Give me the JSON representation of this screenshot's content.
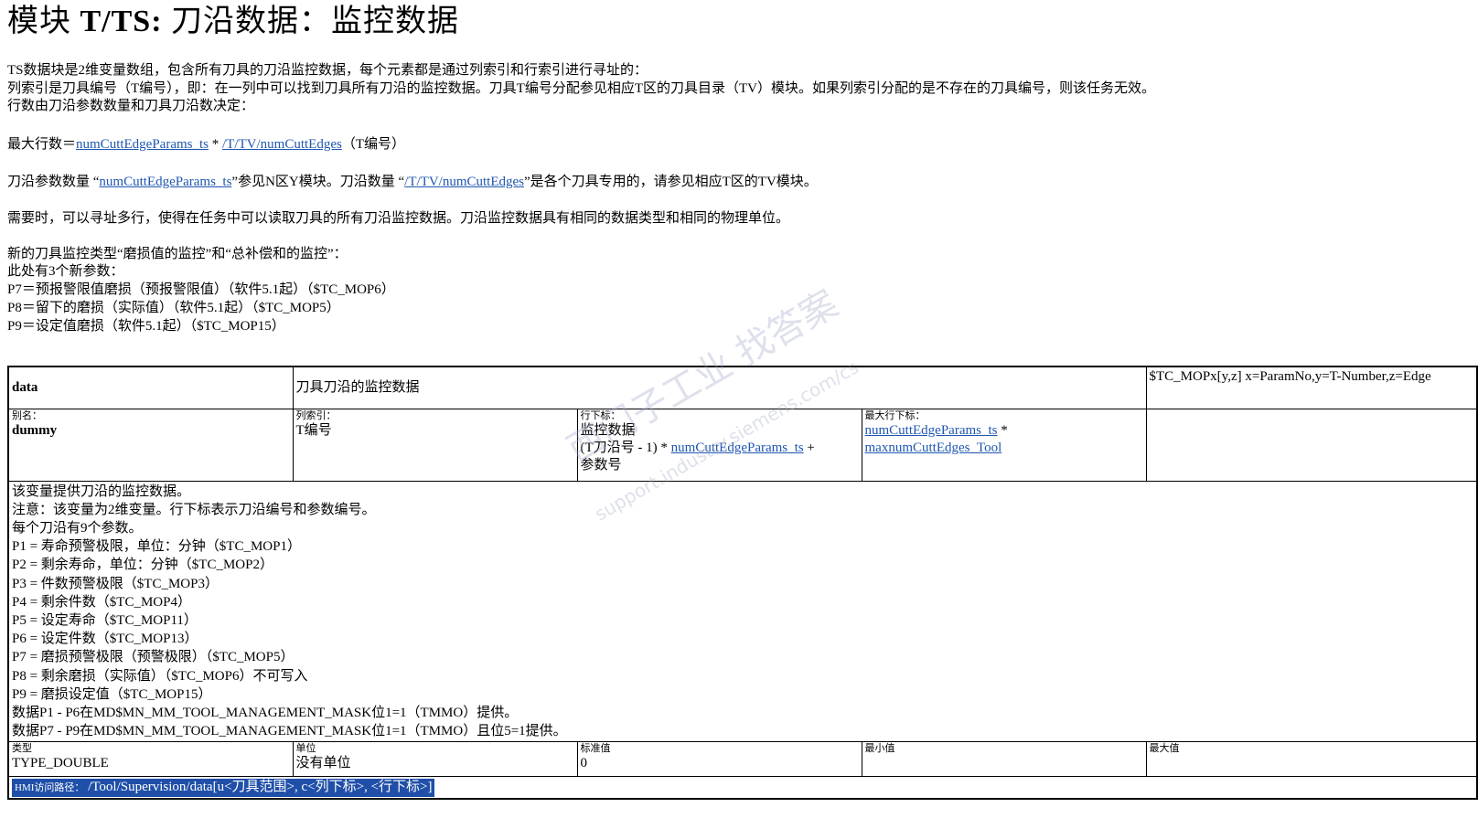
{
  "title": {
    "prefix": "模块",
    "module": "T/TS:",
    "rest": "刀沿数据：监控数据"
  },
  "intro": {
    "line1": "TS数据块是2维变量数组，包含所有刀具的刀沿监控数据，每个元素都是通过列索引和行索引进行寻址的：",
    "line2": "列索引是刀具编号（T编号），即：在一列中可以找到刀具所有刀沿的监控数据。刀具T编号分配参见相应T区的刀具目录（TV）模块。如果列索引分配的是不存在的刀具编号，则该任务无效。",
    "line3": "行数由刀沿参数数量和刀具刀沿数决定："
  },
  "maxrows": {
    "label": "最大行数＝",
    "link1": "numCuttEdgeParams_ts",
    "op": " * ",
    "link2": "/T/TV/numCuttEdges",
    "suffix": "（T编号）"
  },
  "params_note": {
    "part1": "刀沿参数数量 “",
    "link1": "numCuttEdgeParams_ts",
    "part2": "”参见N区Y模块。刀沿数量 “",
    "link2": "/T/TV/numCuttEdges",
    "part3": "”是各个刀具专用的，请参见相应T区的TV模块。"
  },
  "multi_rows": "需要时，可以寻址多行，使得在任务中可以读取刀具的所有刀沿监控数据。刀沿监控数据具有相同的数据类型和相同的物理单位。",
  "new_types": {
    "line1": "新的刀具监控类型“磨损值的监控”和“总补偿和的监控”：",
    "line2": "此处有3个新参数：",
    "line3": "P7＝预报警限值磨损（预报警限值）（软件5.1起）（$TC_MOP6）",
    "line4": "P8＝留下的磨损（实际值）（软件5.1起）（$TC_MOP5）",
    "line5": "P9＝设定值磨损（软件5.1起）（$TC_MOP15）"
  },
  "table": {
    "row1": {
      "name": "data",
      "desc": "刀具刀沿的监控数据",
      "sys": "$TC_MOPx[y,z] x=ParamNo,y=T-Number,z=Edge"
    },
    "row2": {
      "alias_label": "别名：",
      "alias_value": "dummy",
      "col_label": "列索引：",
      "col_value": "T编号",
      "rowidx_label": "行下标：",
      "rowidx_line1": "监控数据",
      "rowidx_line2_pre": "(T刀沿号  - 1) * ",
      "rowidx_link": "numCuttEdgeParams_ts",
      "rowidx_line2_post": " +",
      "rowidx_line3": "参数号",
      "maxrow_label": "最大行下标：",
      "maxrow_link1": "numCuttEdgeParams_ts",
      "maxrow_op": " *",
      "maxrow_link2": "maxnumCuttEdges_Tool"
    },
    "desc_lines": [
      "该变量提供刀沿的监控数据。",
      "注意：该变量为2维变量。行下标表示刀沿编号和参数编号。",
      "每个刀沿有9个参数。",
      "P1 = 寿命预警极限，单位：分钟（$TC_MOP1）",
      "P2 = 剩余寿命，单位：分钟（$TC_MOP2）",
      "P3 = 件数预警极限（$TC_MOP3）",
      "P4 = 剩余件数（$TC_MOP4）",
      "P5 = 设定寿命（$TC_MOP11）",
      "P6 = 设定件数（$TC_MOP13）",
      "P7 = 磨损预警极限（预警极限）（$TC_MOP5）",
      "P8 = 剩余磨损（实际值）（$TC_MOP6）不可写入",
      "P9 = 磨损设定值（$TC_MOP15）",
      "数据P1 - P6在MD$MN_MM_TOOL_MANAGEMENT_MASK位1=1（TMMO）提供。",
      "数据P7 - P9在MD$MN_MM_TOOL_MANAGEMENT_MASK位1=1（TMMO）且位5=1提供。"
    ],
    "row4": {
      "type_label": "类型",
      "type_value": "TYPE_DOUBLE",
      "unit_label": "单位",
      "unit_value": "没有单位",
      "std_label": "标准值",
      "std_value": "0",
      "min_label": "最小值",
      "min_value": "",
      "max_label": "最大值",
      "max_value": ""
    },
    "hmi": {
      "label": "HMI访问路径：",
      "path": "/Tool/Supervision/data[u<刀具范围>, c<列下标>, <行下标>]"
    }
  },
  "watermark": {
    "text1": "西门子工业  找答案",
    "text2": "support.industry.siemens.com/cs"
  }
}
